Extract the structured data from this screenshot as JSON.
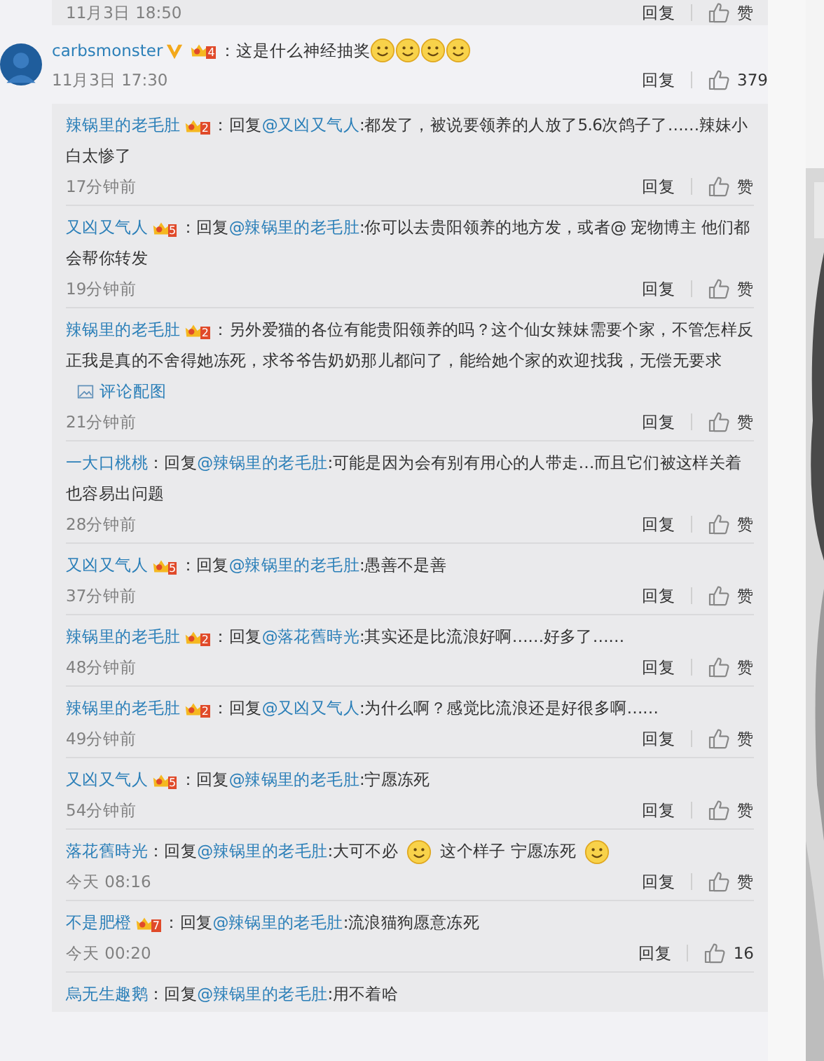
{
  "previous_reply": {
    "time": "11月3日 18:50",
    "reply_label": "回复",
    "like_label": "赞"
  },
  "comment": {
    "user": "carbsmonster",
    "verified": true,
    "badge": "4",
    "parts": [
      {
        "kind": "text",
        "text": "：这是什么神经抽奖"
      },
      {
        "kind": "emoji"
      },
      {
        "kind": "emoji"
      },
      {
        "kind": "emoji"
      },
      {
        "kind": "emoji"
      }
    ],
    "time": "11月3日 17:30",
    "reply_label": "回复",
    "likes": "379"
  },
  "replies": [
    {
      "user": "辣锅里的老毛肚",
      "badge": "2",
      "parts": [
        {
          "kind": "text",
          "text": "：回复"
        },
        {
          "kind": "mention",
          "text": "@又凶又气人"
        },
        {
          "kind": "text",
          "text": ":都发了，被说要领养的人放了5.6次鸽子了……辣妹小白太惨了"
        }
      ],
      "time": "17分钟前",
      "reply_label": "回复",
      "likes": "赞"
    },
    {
      "user": "又凶又气人",
      "badge": "5",
      "parts": [
        {
          "kind": "text",
          "text": "：回复"
        },
        {
          "kind": "mention",
          "text": "@辣锅里的老毛肚"
        },
        {
          "kind": "text",
          "text": ":你可以去贵阳领养的地方发，或者@ 宠物博主 他们都会帮你转发"
        }
      ],
      "time": "19分钟前",
      "reply_label": "回复",
      "likes": "赞"
    },
    {
      "user": "辣锅里的老毛肚",
      "badge": "2",
      "parts": [
        {
          "kind": "text",
          "text": "：另外爱猫的各位有能贵阳领养的吗？这个仙女辣妹需要个家，不管怎样反正我是真的不舍得她冻死，求爷爷告奶奶那儿都问了，能给她个家的欢迎找我，无偿无要求"
        }
      ],
      "image_link": "评论配图",
      "time": "21分钟前",
      "reply_label": "回复",
      "likes": "赞"
    },
    {
      "user": "一大口桃桃",
      "parts": [
        {
          "kind": "text",
          "text": "：回复"
        },
        {
          "kind": "mention",
          "text": "@辣锅里的老毛肚"
        },
        {
          "kind": "text",
          "text": ":可能是因为会有别有用心的人带走…而且它们被这样关着也容易出问题"
        }
      ],
      "time": "28分钟前",
      "reply_label": "回复",
      "likes": "赞"
    },
    {
      "user": "又凶又气人",
      "badge": "5",
      "parts": [
        {
          "kind": "text",
          "text": "：回复"
        },
        {
          "kind": "mention",
          "text": "@辣锅里的老毛肚"
        },
        {
          "kind": "text",
          "text": ":愚善不是善"
        }
      ],
      "time": "37分钟前",
      "reply_label": "回复",
      "likes": "赞"
    },
    {
      "user": "辣锅里的老毛肚",
      "badge": "2",
      "parts": [
        {
          "kind": "text",
          "text": "：回复"
        },
        {
          "kind": "mention",
          "text": "@落花舊時光"
        },
        {
          "kind": "text",
          "text": ":其实还是比流浪好啊……好多了……"
        }
      ],
      "time": "48分钟前",
      "reply_label": "回复",
      "likes": "赞"
    },
    {
      "user": "辣锅里的老毛肚",
      "badge": "2",
      "parts": [
        {
          "kind": "text",
          "text": "：回复"
        },
        {
          "kind": "mention",
          "text": "@又凶又气人"
        },
        {
          "kind": "text",
          "text": ":为什么啊？感觉比流浪还是好很多啊……"
        }
      ],
      "time": "49分钟前",
      "reply_label": "回复",
      "likes": "赞"
    },
    {
      "user": "又凶又气人",
      "badge": "5",
      "parts": [
        {
          "kind": "text",
          "text": "：回复"
        },
        {
          "kind": "mention",
          "text": "@辣锅里的老毛肚"
        },
        {
          "kind": "text",
          "text": ":宁愿冻死"
        }
      ],
      "time": "54分钟前",
      "reply_label": "回复",
      "likes": "赞"
    },
    {
      "user": "落花舊時光",
      "parts": [
        {
          "kind": "text",
          "text": "：回复"
        },
        {
          "kind": "mention",
          "text": "@辣锅里的老毛肚"
        },
        {
          "kind": "text",
          "text": ":大可不必"
        },
        {
          "kind": "emoji"
        },
        {
          "kind": "text",
          "text": "这个样子  宁愿冻死"
        },
        {
          "kind": "emoji"
        }
      ],
      "time": "今天 08:16",
      "reply_label": "回复",
      "likes": "赞"
    },
    {
      "user": "不是肥橙",
      "badge": "7",
      "parts": [
        {
          "kind": "text",
          "text": "：回复"
        },
        {
          "kind": "mention",
          "text": "@辣锅里的老毛肚"
        },
        {
          "kind": "text",
          "text": ":流浪猫狗愿意冻死"
        }
      ],
      "time": "今天 00:20",
      "reply_label": "回复",
      "likes": "16"
    },
    {
      "user": "烏无生趣鹅",
      "parts": [
        {
          "kind": "text",
          "text": "：回复"
        },
        {
          "kind": "mention",
          "text": "@辣锅里的老毛肚"
        },
        {
          "kind": "text",
          "text": ":用不着哈"
        }
      ]
    }
  ]
}
